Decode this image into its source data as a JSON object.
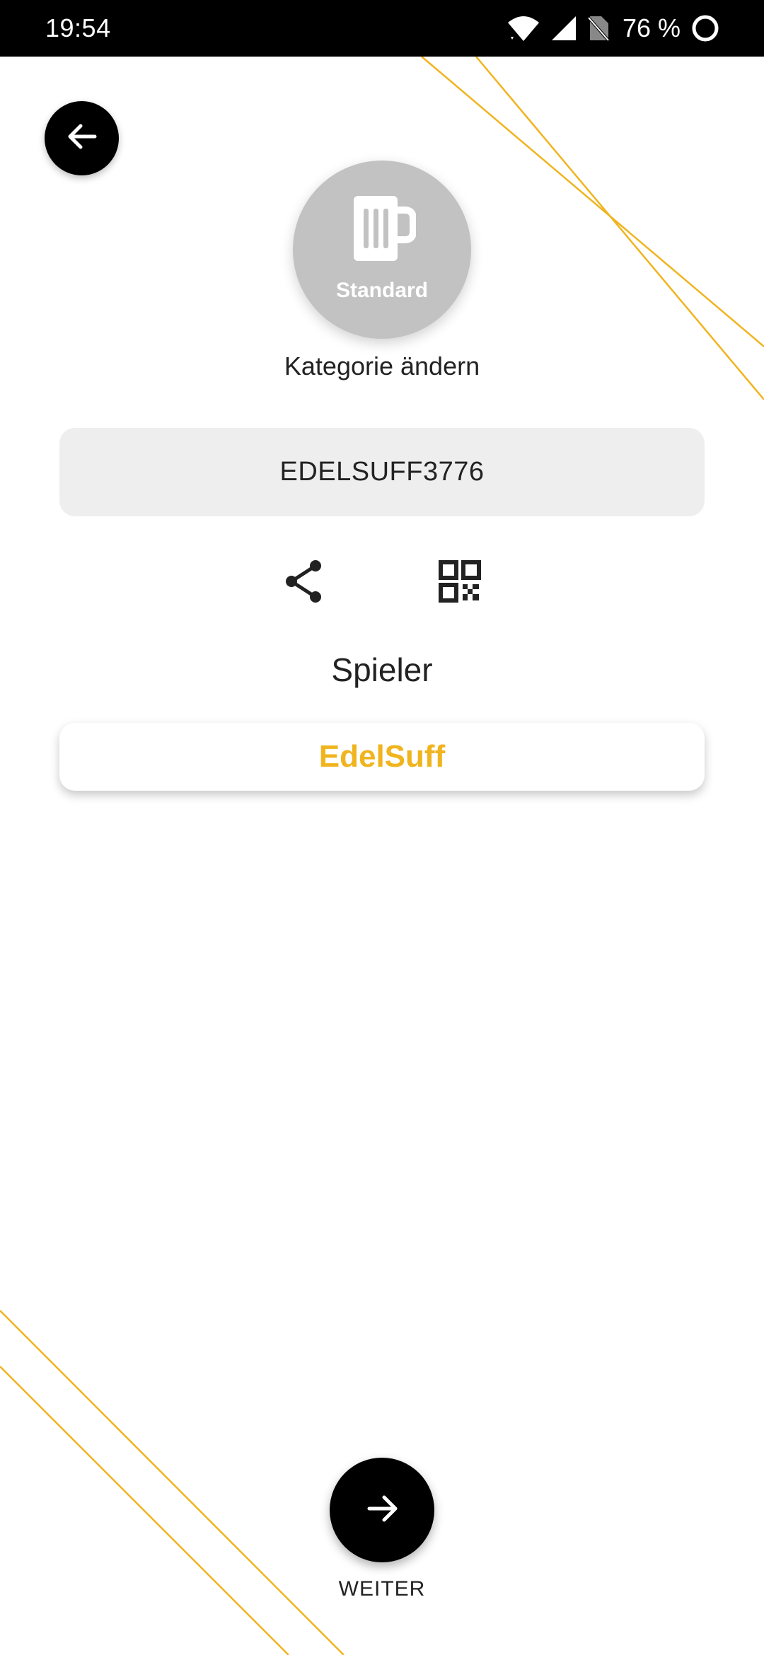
{
  "status_bar": {
    "time": "19:54",
    "battery": "76 %",
    "icons": [
      "wifi-icon",
      "cell-signal-icon",
      "no-sim-icon",
      "battery-ring-icon"
    ]
  },
  "header": {
    "back_icon": "arrow-left-icon"
  },
  "category": {
    "icon": "beer-mug-icon",
    "label": "Standard",
    "change_link": "Kategorie ändern",
    "circle_color": "#C2C2C2"
  },
  "game_code": {
    "value": "EDELSUFF3776"
  },
  "actions": {
    "share_icon": "share-icon",
    "qr_icon": "qr-code-icon"
  },
  "players": {
    "heading": "Spieler",
    "list": [
      {
        "name": "EdelSuff"
      }
    ]
  },
  "footer": {
    "next_icon": "arrow-right-icon",
    "next_label": "WEITER"
  },
  "colors": {
    "accent": "#F0B41E",
    "dark": "#000000",
    "field_bg": "#EEEEEE"
  }
}
